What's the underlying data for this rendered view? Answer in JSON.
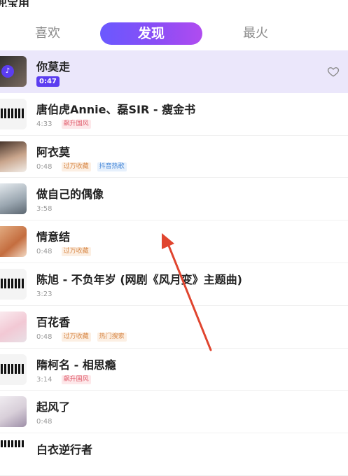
{
  "header": {
    "title_fragment": "兜宝用"
  },
  "tabs": [
    {
      "label": "喜欢",
      "selected": false
    },
    {
      "label": "发现",
      "selected": true
    },
    {
      "label": "最火",
      "selected": false
    }
  ],
  "colors": {
    "accent": "#6a59ff",
    "active_row": "#ebe7fb",
    "badge_red": "#e05a6a",
    "badge_orange": "#d88a4a",
    "badge_blue": "#4a8ad8",
    "annotation_arrow": "#e0452f"
  },
  "songs": [
    {
      "title": "你莫走",
      "duration": "0:47",
      "tags": [],
      "active": true,
      "favorite_icon": "heart-outline-icon"
    },
    {
      "title": "唐伯虎Annie、磊SIR - 瘦金书",
      "duration": "4:33",
      "tags": [
        {
          "text": "飙升国风",
          "color": "red"
        }
      ]
    },
    {
      "title": "阿衣莫",
      "duration": "0:48",
      "tags": [
        {
          "text": "过万收藏",
          "color": "orange"
        },
        {
          "text": "抖音热歌",
          "color": "blue"
        }
      ]
    },
    {
      "title": "做自己的偶像",
      "duration": "3:58",
      "tags": []
    },
    {
      "title": "情意结",
      "duration": "0:48",
      "tags": [
        {
          "text": "过万收藏",
          "color": "orange"
        }
      ]
    },
    {
      "title": "陈旭 - 不负年岁 (网剧《风月变》主题曲)",
      "duration": "3:23",
      "tags": []
    },
    {
      "title": "百花香",
      "duration": "0:48",
      "tags": [
        {
          "text": "过万收藏",
          "color": "orange"
        },
        {
          "text": "热门搜索",
          "color": "orange"
        }
      ]
    },
    {
      "title": "隋柯名 - 相思瘾",
      "duration": "3:14",
      "tags": [
        {
          "text": "飙升国风",
          "color": "red"
        }
      ]
    },
    {
      "title": "起风了",
      "duration": "0:48",
      "tags": []
    },
    {
      "title": "白衣逆行者",
      "duration": "",
      "tags": []
    }
  ]
}
